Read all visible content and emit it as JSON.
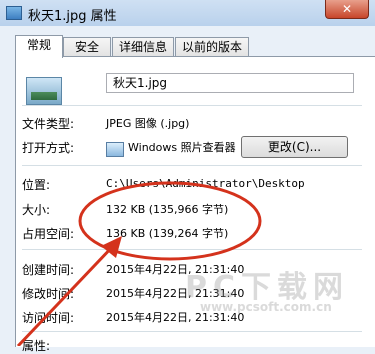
{
  "window": {
    "title": "秋天1.jpg 属性",
    "close_label": "✕"
  },
  "tabs": [
    {
      "label": "常规",
      "active": true
    },
    {
      "label": "安全"
    },
    {
      "label": "详细信息"
    },
    {
      "label": "以前的版本"
    }
  ],
  "general": {
    "file_name": "秋天1.jpg",
    "file_type_label": "文件类型:",
    "file_type_value": "JPEG 图像 (.jpg)",
    "open_with_label": "打开方式:",
    "open_with_value": "Windows 照片查看器",
    "change_button": "更改(C)...",
    "location_label": "位置:",
    "location_value": "C:\\Users\\Administrator\\Desktop",
    "size_label": "大小:",
    "size_value": "132 KB (135,966 字节)",
    "disk_size_label": "占用空间:",
    "disk_size_value": "136 KB (139,264 字节)",
    "created_label": "创建时间:",
    "created_value": "2015年4月22日, 21:31:40",
    "modified_label": "修改时间:",
    "modified_value": "2015年4月22日, 21:31:40",
    "accessed_label": "访问时间:",
    "accessed_value": "2015年4月22日, 21:31:40",
    "attributes_label": "属性:"
  },
  "watermark": {
    "brand": "PC下载网",
    "url": "www.pcsoft.com.cn"
  },
  "colors": {
    "annotation": "#d4321c"
  }
}
